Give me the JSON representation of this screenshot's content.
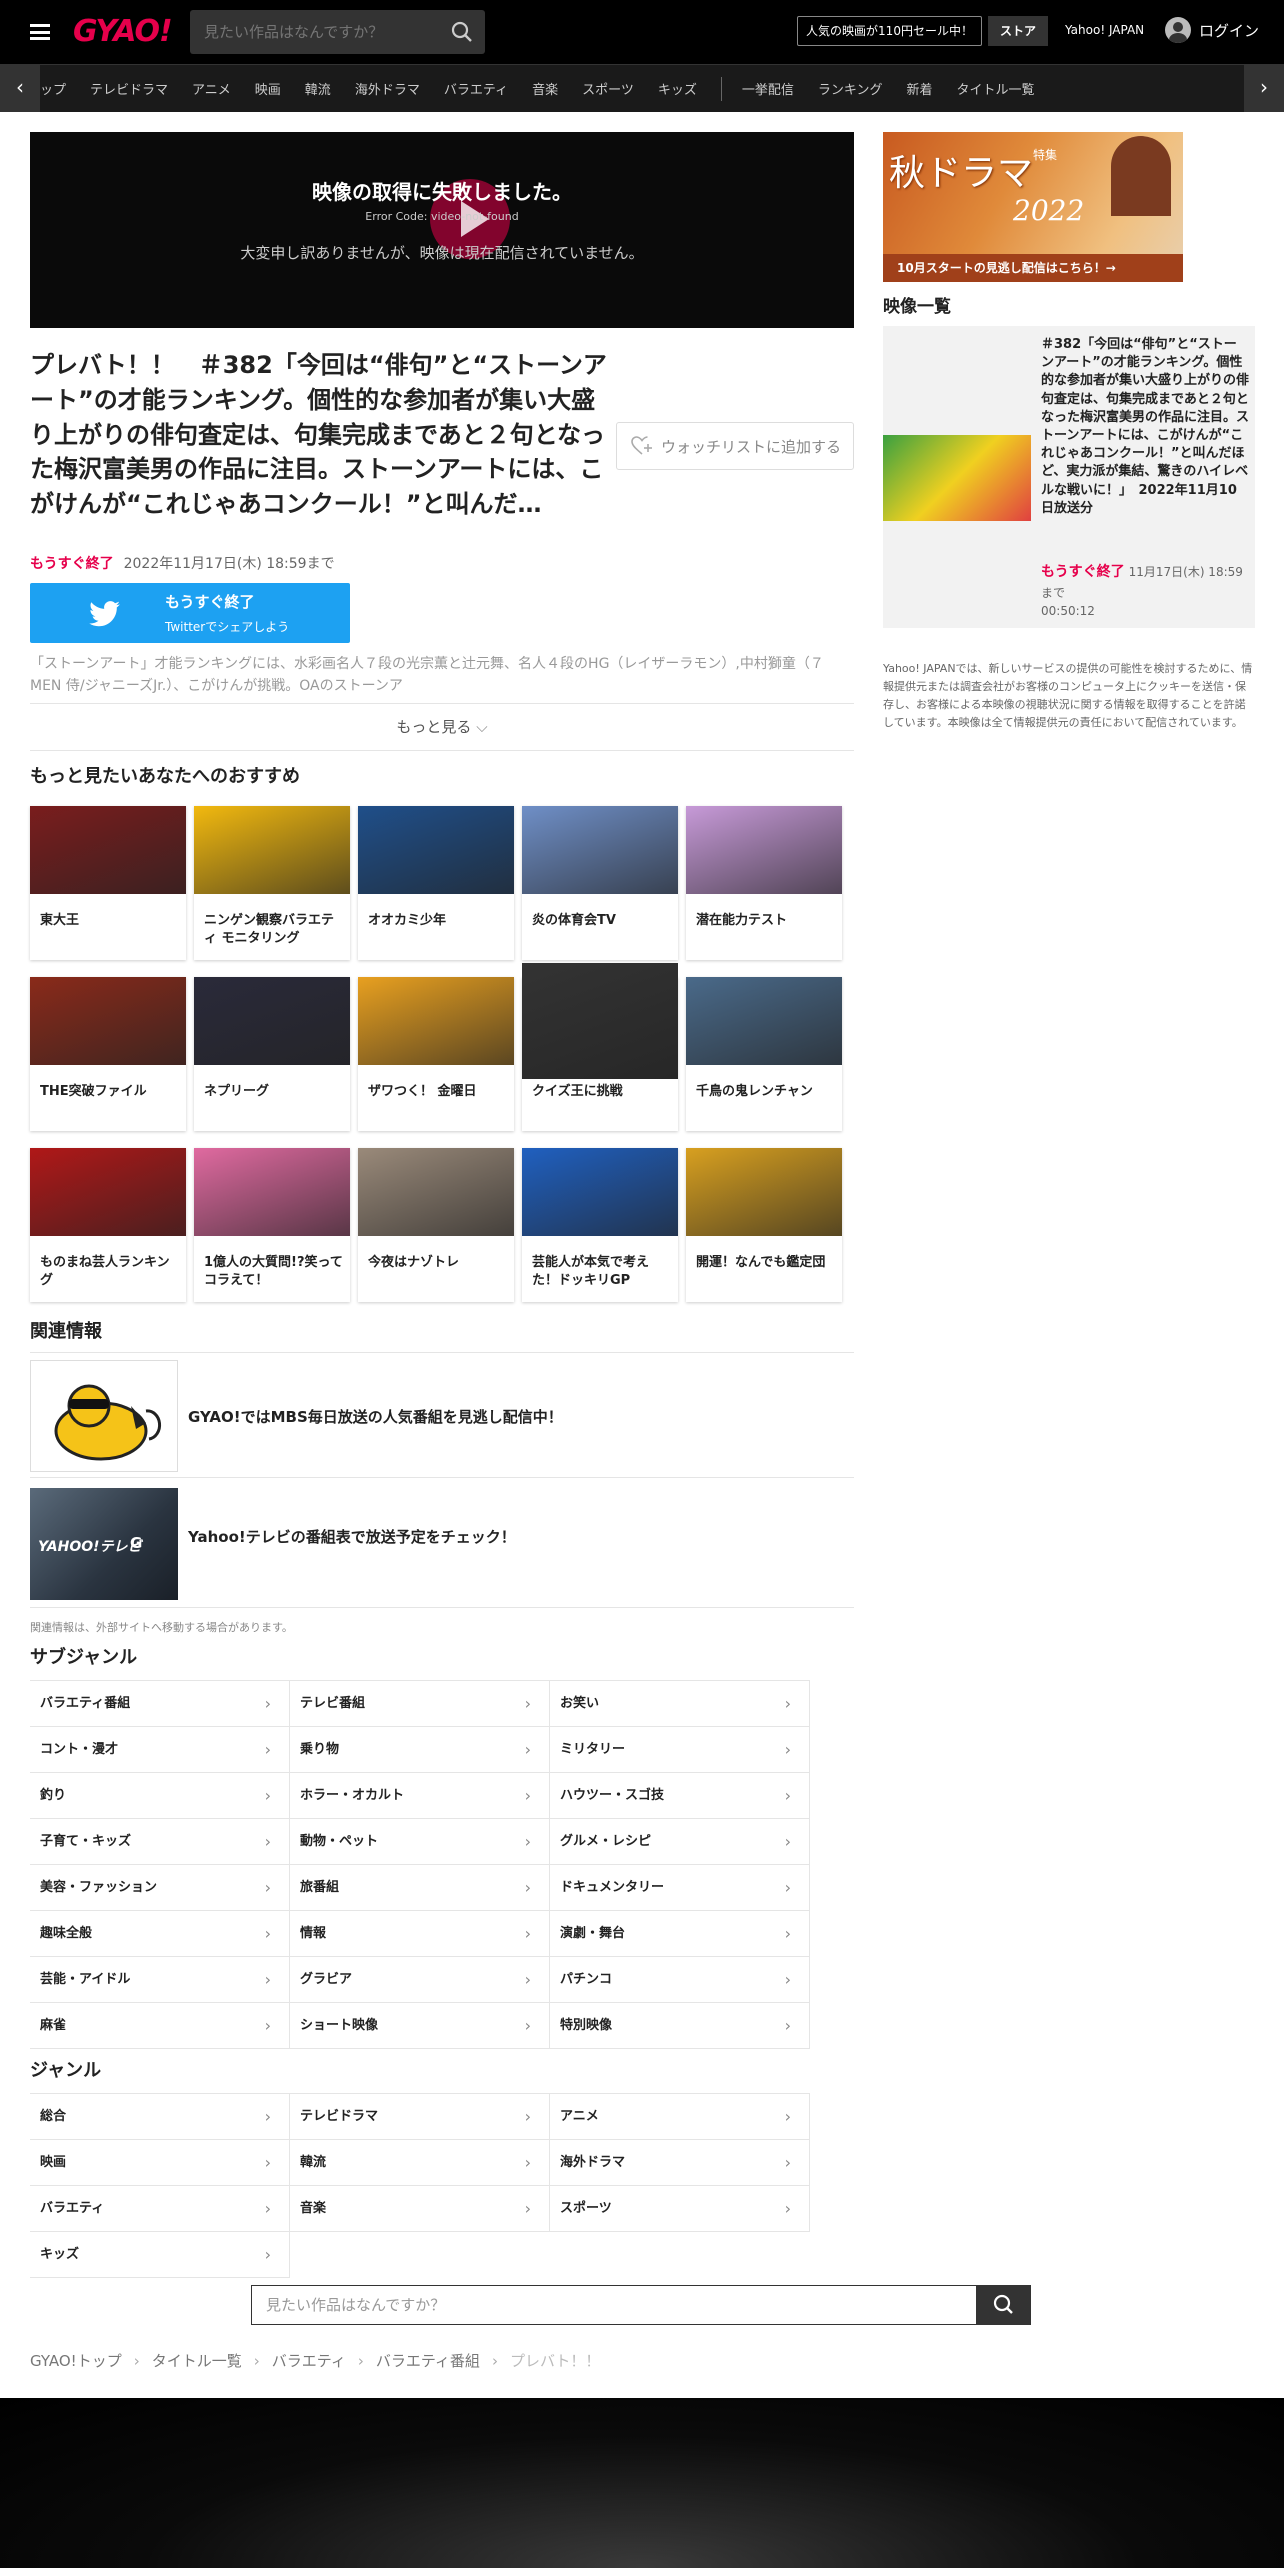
{
  "header": {
    "logo": "GYAO!",
    "search_placeholder": "見たい作品はなんですか？",
    "sale_label": "人気の映画が110円セール中！",
    "store_label": "ストア",
    "yahoo_label": "Yahoo! JAPAN",
    "login_label": "ログイン"
  },
  "nav": {
    "items": [
      "ップ",
      "テレビドラマ",
      "アニメ",
      "映画",
      "韓流",
      "海外ドラマ",
      "バラエティ",
      "音楽",
      "スポーツ",
      "キッズ",
      "一挙配信",
      "ランキング",
      "新着",
      "タイトル一覧"
    ]
  },
  "player": {
    "error_title": "映像の取得に失敗しました。",
    "error_code": "Error Code: video-not-found",
    "error_message": "大変申し訳ありませんが、映像は現在配信されていません。"
  },
  "video": {
    "title": "プレバト！！　＃382「今回は“俳句”と“ストーンアート”の才能ランキング。個性的な参加者が集い大盛り上がりの俳句査定は、句集完成まであと２句となった梅沢富美男の作品に注目。ストーンアートには、こがけんが“これじゃあコンクール！”と叫んだ…",
    "watchlist_label": "ウォッチリストに追加する",
    "soon_label": "もうすぐ終了",
    "until": "2022年11月17日(木) 18:59まで",
    "share_title": "もうすぐ終了",
    "share_sub": "Twitterでシェアしよう",
    "description": "「ストーンアート」才能ランキングには、水彩画名人７段の光宗薫と辻元舞、名人４段のHG（レイザーラモン）,中村獅童（７MEN 侍/ジャニーズJr.）、こがけんが挑戦。OAのストーンア",
    "more_label": "もっと見る"
  },
  "recommend": {
    "heading": "もっと見たいあなたへのおすすめ",
    "items": [
      {
        "title": "東大王",
        "color": "#7a1d1d"
      },
      {
        "title": "ニンゲン観察バラエティ モニタリング",
        "color": "#f2b90f"
      },
      {
        "title": "オオカミ少年",
        "color": "#1f4f8a"
      },
      {
        "title": "炎の体育会TV",
        "color": "#6f8fc7"
      },
      {
        "title": "潜在能力テスト",
        "color": "#c79ad8"
      },
      {
        "title": "THE突破ファイル",
        "color": "#8a2a1a"
      },
      {
        "title": "ネプリーグ",
        "color": "#2a2a3a"
      },
      {
        "title": "ザワつく！ 金曜日",
        "color": "#e8a020"
      },
      {
        "title": "クイズ王に挑戦",
        "color": "#333333"
      },
      {
        "title": "千鳥の鬼レンチャン",
        "color": "#4a6a8a"
      },
      {
        "title": "ものまね芸人ランキング",
        "color": "#b01818"
      },
      {
        "title": "1億人の大質問!?笑ってコラえて！",
        "color": "#e06aa0"
      },
      {
        "title": "今夜はナゾトレ",
        "color": "#9a8a7a"
      },
      {
        "title": "芸能人が本気で考えた！ドッキリGP",
        "color": "#2060c0"
      },
      {
        "title": "開運！なんでも鑑定団",
        "color": "#d8a020"
      }
    ]
  },
  "related": {
    "heading": "関連情報",
    "items": [
      {
        "title": "GYAO!ではMBS毎日放送の人気番組を見逃し配信中！"
      },
      {
        "title": "Yahoo!テレビの番組表で放送予定をチェック！"
      }
    ],
    "note": "関連情報は、外部サイトへ移動する場合があります。"
  },
  "subgenre": {
    "heading": "サブジャンル",
    "items": [
      "バラエティ番組",
      "テレビ番組",
      "お笑い",
      "コント・漫才",
      "乗り物",
      "ミリタリー",
      "釣り",
      "ホラー・オカルト",
      "ハウツー・スゴ技",
      "子育て・キッズ",
      "動物・ペット",
      "グルメ・レシピ",
      "美容・ファッション",
      "旅番組",
      "ドキュメンタリー",
      "趣味全般",
      "情報",
      "演劇・舞台",
      "芸能・アイドル",
      "グラビア",
      "パチンコ",
      "麻雀",
      "ショート映像",
      "特別映像"
    ]
  },
  "genre": {
    "heading": "ジャンル",
    "items": [
      "総合",
      "テレビドラマ",
      "アニメ",
      "映画",
      "韓流",
      "海外ドラマ",
      "バラエティ",
      "音楽",
      "スポーツ",
      "キッズ"
    ]
  },
  "bottom_search": {
    "placeholder": "見たい作品はなんですか？"
  },
  "breadcrumb": [
    "GYAO!トップ",
    "タイトル一覧",
    "バラエティ",
    "バラエティ番組",
    "プレバト！！"
  ],
  "sidebar": {
    "banner_title": "秋ドラマ",
    "banner_sub": "特集",
    "banner_year": "2022",
    "banner_cta": "10月スタートの見逃し配信はこちら！→",
    "list_heading": "映像一覧",
    "item_title": "＃382「今回は“俳句”と“ストーンアート”の才能ランキング。個性的な参加者が集い大盛り上がりの俳句査定は、句集完成まであと２句となった梅沢富美男の作品に注目。ストーンアートには、こがけんが“これじゃあコンクール！”と叫んだほど、実力派が集結、驚きのハイレベルな戦いに！」　2022年11月10日放送分",
    "item_soon": "もうすぐ終了",
    "item_until": "11月17日(木) 18:59まで",
    "item_duration": "00:50:12",
    "note": "Yahoo! JAPANでは、新しいサービスの提供の可能性を検討するために、情報提供元または調査会社がお客様のコンピュータ上にクッキーを送信・保存し、お客様による本映像の視聴状況に関する情報を取得することを許諾しています。本映像は全て情報提供元の責任において配信されています。"
  },
  "colors": {
    "accent": "#e6004b",
    "twitter": "#1da1f2"
  }
}
